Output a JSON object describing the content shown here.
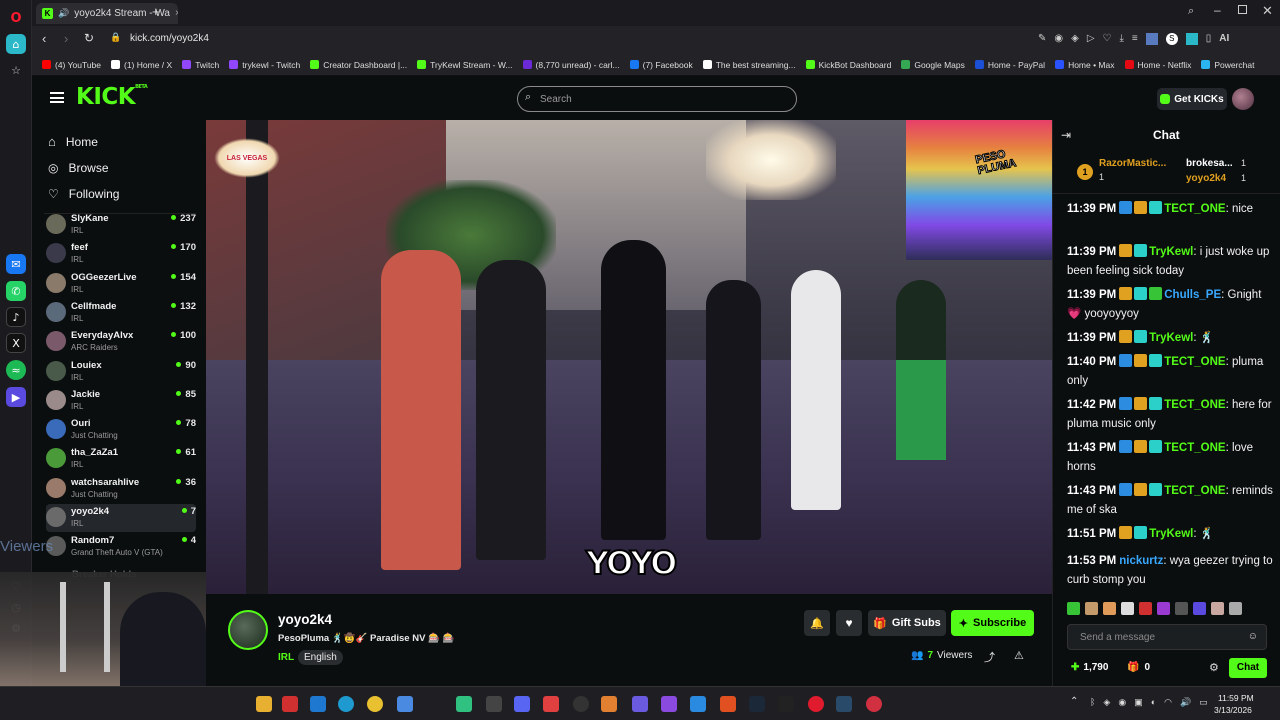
{
  "browser": {
    "tab_title": "yoyo2k4 Stream - Wa",
    "new_tab": "+",
    "url": "kick.com/yoyo2k4",
    "ai_label": "AI"
  },
  "bookmarks": [
    {
      "label": "(4) YouTube",
      "color": "#ff0000"
    },
    {
      "label": "(1) Home / X",
      "color": "#ffffff"
    },
    {
      "label": "Twitch",
      "color": "#9146ff"
    },
    {
      "label": "trykewl - Twitch",
      "color": "#9146ff"
    },
    {
      "label": "Creator Dashboard |...",
      "color": "#53fc18"
    },
    {
      "label": "TryKewl Stream - W...",
      "color": "#53fc18"
    },
    {
      "label": "(8,770 unread) - carl...",
      "color": "#6a2bd6"
    },
    {
      "label": "(7) Facebook",
      "color": "#1877f2"
    },
    {
      "label": "The best streaming...",
      "color": "#ffffff"
    },
    {
      "label": "KickBot Dashboard",
      "color": "#53fc18"
    },
    {
      "label": "Google Maps",
      "color": "#34a853"
    },
    {
      "label": "Home - PayPal",
      "color": "#1b4fd6"
    },
    {
      "label": "Home • Max",
      "color": "#2a52ff"
    },
    {
      "label": "Home - Netflix",
      "color": "#e50914"
    },
    {
      "label": "Powerchat",
      "color": "#2bb5f0"
    }
  ],
  "kick": {
    "logo": "KICK",
    "beta": "BETA",
    "search_placeholder": "Search",
    "get_kicks": "Get KICKs"
  },
  "sidebar": {
    "nav": [
      {
        "label": "Home",
        "icon": "home-icon"
      },
      {
        "label": "Browse",
        "icon": "compass-icon"
      },
      {
        "label": "Following",
        "icon": "heart-icon"
      }
    ],
    "channels": [
      {
        "name": "SlyKane",
        "category": "IRL",
        "viewers": "237",
        "color": "#6a6a5a"
      },
      {
        "name": "feef",
        "category": "IRL",
        "viewers": "170",
        "color": "#3a3a4a"
      },
      {
        "name": "OGGeezerLive",
        "category": "IRL",
        "viewers": "154",
        "color": "#8a7a6a"
      },
      {
        "name": "Cellfmade",
        "category": "IRL",
        "viewers": "132",
        "color": "#5a6a7a"
      },
      {
        "name": "EverydayAlvx",
        "category": "ARC Raiders",
        "viewers": "100",
        "color": "#7a5a6a"
      },
      {
        "name": "Louiex",
        "category": "IRL",
        "viewers": "90",
        "color": "#4a5a4a"
      },
      {
        "name": "Jackie",
        "category": "IRL",
        "viewers": "85",
        "color": "#9a8a8a"
      },
      {
        "name": "Ouri",
        "category": "Just Chatting",
        "viewers": "78",
        "color": "#3a6aba"
      },
      {
        "name": "tha_ZaZa1",
        "category": "IRL",
        "viewers": "61",
        "color": "#4a9a3a"
      },
      {
        "name": "watchsarahlive",
        "category": "Just Chatting",
        "viewers": "36",
        "color": "#9a7a6a"
      },
      {
        "name": "yoyo2k4",
        "category": "IRL",
        "viewers": "7",
        "color": "#6a6a6a"
      },
      {
        "name": "Random7",
        "category": "Grand Theft Auto V (GTA)",
        "viewers": "4",
        "color": "#5a5a5a"
      }
    ],
    "partial_channel": "Breaker Holds",
    "viewers_overlay": "Viewers"
  },
  "video": {
    "watermark_left": "LAS VEGAS",
    "watermark_right": "PESO PLUMA",
    "watermark_bottom": "YOYO"
  },
  "stream": {
    "name": "yoyo2k4",
    "title": "PesoPluma 🕺🤠🎸 Paradise NV 🎰 🎰",
    "category": "IRL",
    "language": "English",
    "gift_subs": "Gift Subs",
    "subscribe": "Subscribe",
    "viewers_count": "7",
    "viewers_label": "Viewers"
  },
  "chat": {
    "title": "Chat",
    "pinned": [
      {
        "rank": "1",
        "name": "RazorMastic...",
        "count": "1"
      },
      {
        "name": "brokesa...",
        "count": "1"
      },
      {
        "name": "yoyo2k4",
        "count": "1"
      }
    ],
    "messages": [
      {
        "time": "11:39 PM",
        "badges": [
          "blue",
          "gold",
          "teal"
        ],
        "user": "TECT_ONE",
        "user_color": "#53fc18",
        "text": "nice"
      },
      {
        "time": "11:39 PM",
        "badges": [
          "gold",
          "teal"
        ],
        "user": "TryKewl",
        "user_color": "#53fc18",
        "text": "i just woke up been feeling sick today"
      },
      {
        "time": "11:39 PM",
        "badges": [
          "gold",
          "teal",
          "green"
        ],
        "user": "Chulls_PE",
        "user_color": "#38a8ff",
        "text": "Gnight 💗 yooyoyyoy"
      },
      {
        "time": "11:39 PM",
        "badges": [
          "gold",
          "teal"
        ],
        "user": "TryKewl",
        "user_color": "#53fc18",
        "text": "🕺"
      },
      {
        "time": "11:40 PM",
        "badges": [
          "blue",
          "gold",
          "teal"
        ],
        "user": "TECT_ONE",
        "user_color": "#53fc18",
        "text": "pluma only"
      },
      {
        "time": "11:42 PM",
        "badges": [
          "blue",
          "gold",
          "teal"
        ],
        "user": "TECT_ONE",
        "user_color": "#53fc18",
        "text": "here for pluma music only"
      },
      {
        "time": "11:43 PM",
        "badges": [
          "blue",
          "gold",
          "teal"
        ],
        "user": "TECT_ONE",
        "user_color": "#53fc18",
        "text": "love horns"
      },
      {
        "time": "11:43 PM",
        "badges": [
          "blue",
          "gold",
          "teal"
        ],
        "user": "TECT_ONE",
        "user_color": "#53fc18",
        "text": "reminds me of ska"
      },
      {
        "time": "11:51 PM",
        "badges": [
          "gold",
          "teal"
        ],
        "user": "TryKewl",
        "user_color": "#53fc18",
        "text": "🕺"
      },
      {
        "time": "11:53 PM",
        "badges": [],
        "user": "nickurtz",
        "user_color": "#38a8ff",
        "text": "wya geezer trying to curb stomp you"
      }
    ],
    "send_placeholder": "Send a message",
    "kicks_count": "1,790",
    "gifts_count": "0",
    "chat_button": "Chat"
  },
  "taskbar": {
    "time": "11:59 PM",
    "date": "3/13/2026"
  }
}
